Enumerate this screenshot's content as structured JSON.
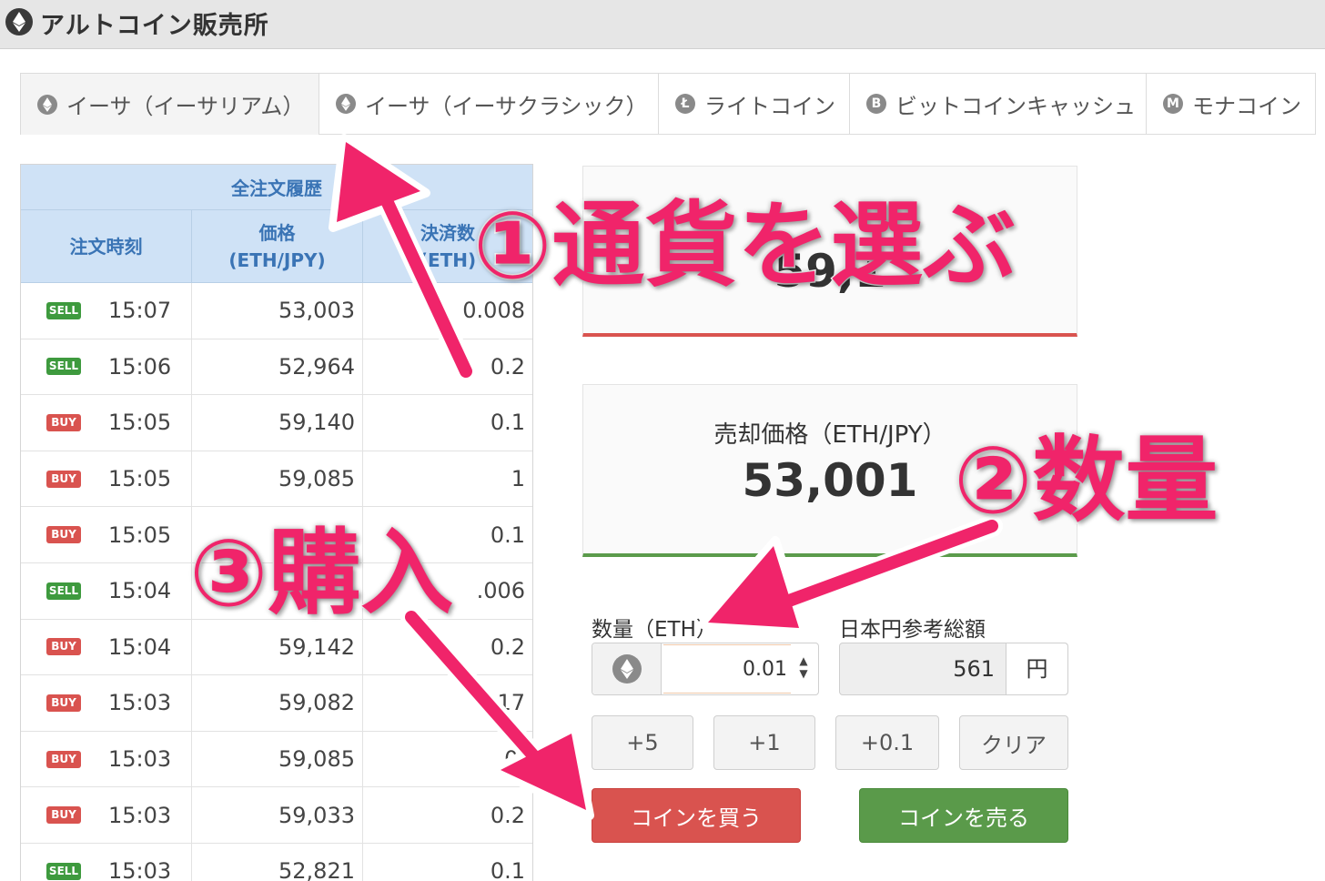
{
  "header": {
    "title": "アルトコイン販売所",
    "icon": "ethereum-icon"
  },
  "tabs": [
    {
      "label": "イーサ（イーサリアム）",
      "icon": "ethereum-icon",
      "glyph": "",
      "active": true
    },
    {
      "label": "イーサ（イーサクラシック）",
      "icon": "ethereum-classic-icon",
      "glyph": "",
      "active": false
    },
    {
      "label": "ライトコイン",
      "icon": "litecoin-icon",
      "glyph": "Ł",
      "active": false
    },
    {
      "label": "ビットコインキャッシュ",
      "icon": "bitcoin-cash-icon",
      "glyph": "B",
      "active": false
    },
    {
      "label": "モナコイン",
      "icon": "monacoin-icon",
      "glyph": "M",
      "active": false
    }
  ],
  "history": {
    "caption": "全注文履歴",
    "columns": [
      "注文時刻",
      "価格\n(ETH/JPY)",
      "決済数\n(ETH)"
    ],
    "rows": [
      {
        "side": "SELL",
        "time": "15:07",
        "price": "53,003",
        "qty": "0.008"
      },
      {
        "side": "SELL",
        "time": "15:06",
        "price": "52,964",
        "qty": "0.2"
      },
      {
        "side": "BUY",
        "time": "15:05",
        "price": "59,140",
        "qty": "0.1"
      },
      {
        "side": "BUY",
        "time": "15:05",
        "price": "59,085",
        "qty": "1"
      },
      {
        "side": "BUY",
        "time": "15:05",
        "price": "",
        "qty": "0.1"
      },
      {
        "side": "SELL",
        "time": "15:04",
        "price": "",
        "qty": ".006"
      },
      {
        "side": "BUY",
        "time": "15:04",
        "price": "59,142",
        "qty": "0.2"
      },
      {
        "side": "BUY",
        "time": "15:03",
        "price": "59,082",
        "qty": "17"
      },
      {
        "side": "BUY",
        "time": "15:03",
        "price": "59,085",
        "qty": "0."
      },
      {
        "side": "BUY",
        "time": "15:03",
        "price": "59,033",
        "qty": "0.2"
      },
      {
        "side": "SELL",
        "time": "15:03",
        "price": "52,821",
        "qty": "0.1"
      }
    ]
  },
  "buy_panel": {
    "label": "",
    "value": "59,1"
  },
  "sell_panel": {
    "label": "売却価格（ETH/JPY）",
    "value": "53,001"
  },
  "order": {
    "qty_label": "数量（ETH）",
    "qty_value": "0.01",
    "jpy_label": "日本円参考総額",
    "jpy_value": "561",
    "jpy_unit": "円",
    "quick_buttons": [
      "+5",
      "+1",
      "+0.1",
      "クリア"
    ],
    "buy_label": "コインを買う",
    "sell_label": "コインを売る"
  },
  "annotations": {
    "step1": "①通貨を選ぶ",
    "step2": "②数量",
    "step3": "③購入"
  },
  "colors": {
    "accent_pink": "#f0246a",
    "buy_red": "#d9534f",
    "sell_green": "#5a9a4a",
    "table_header_blue": "#cfe2f6"
  }
}
